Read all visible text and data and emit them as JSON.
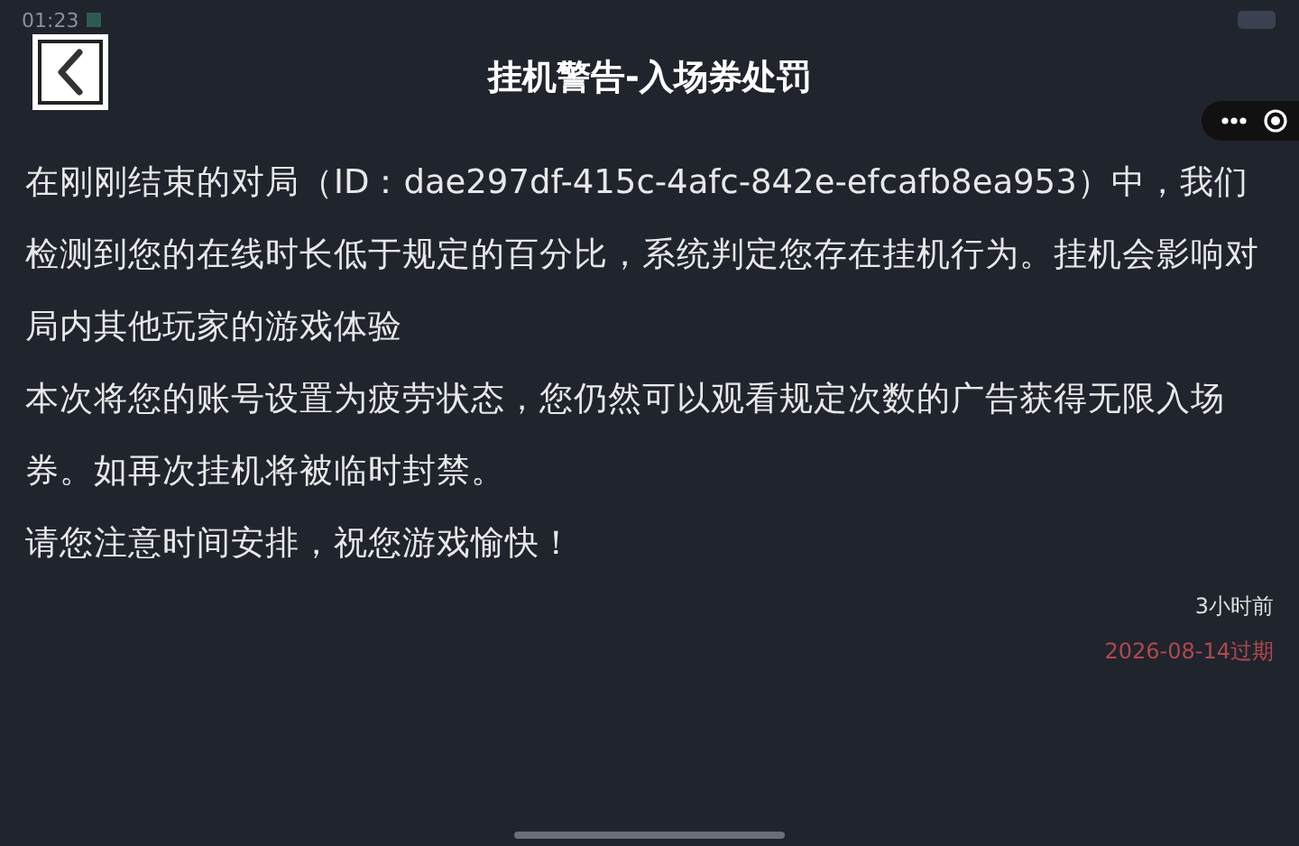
{
  "status_bar": {
    "time": "01:23"
  },
  "header": {
    "title": "挂机警告-入场券处罚"
  },
  "message": {
    "paragraphs": [
      "在刚刚结束的对局（ID：dae297df-415c-4afc-842e-efcafb8ea953）中，我们检测到您的在线时长低于规定的百分比，系统判定您存在挂机行为。挂机会影响对局内其他玩家的游戏体验",
      "本次将您的账号设置为疲劳状态，您仍然可以观看规定次数的广告获得无限入场券。如再次挂机将被临时封禁。",
      "请您注意时间安排，祝您游戏愉快！"
    ],
    "time_ago": "3小时前",
    "expiry": "2026-08-14过期"
  }
}
